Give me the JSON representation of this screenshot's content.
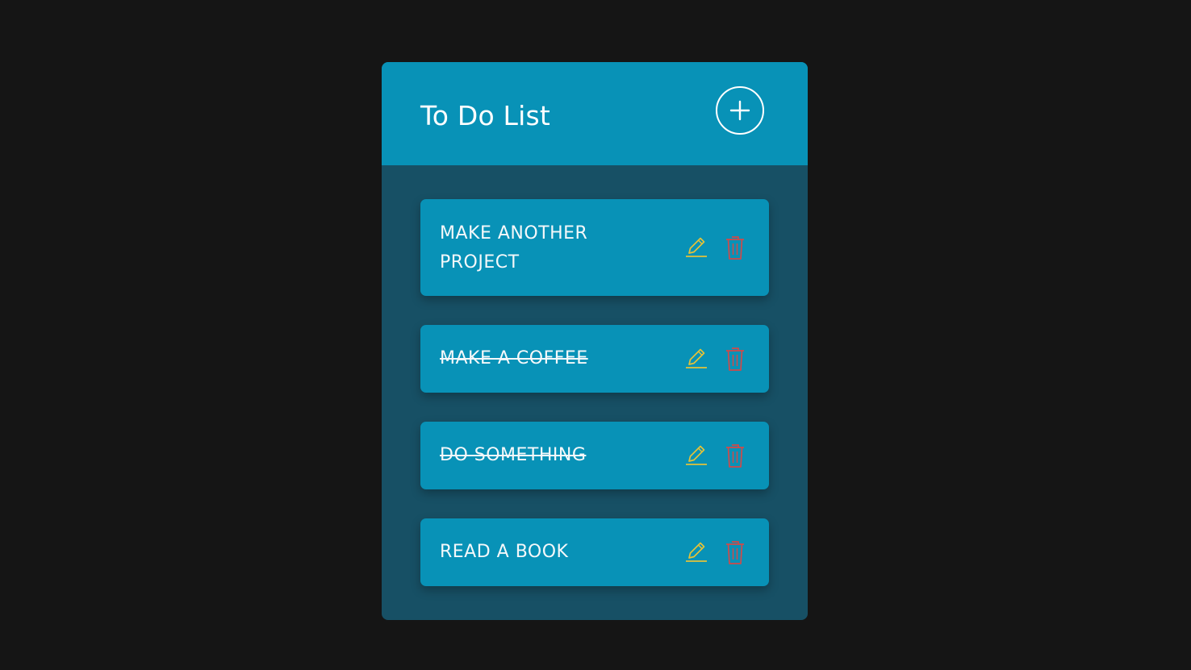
{
  "header": {
    "title": "To Do List"
  },
  "items": [
    {
      "label": "Make another project",
      "completed": false
    },
    {
      "label": "Make a coffee",
      "completed": true
    },
    {
      "label": "Do something",
      "completed": true
    },
    {
      "label": "Read a book",
      "completed": false
    }
  ],
  "icons": {
    "add": "plus-circle-icon",
    "edit": "pencil-icon",
    "delete": "trash-icon"
  },
  "colors": {
    "background": "#151515",
    "card": "#175065",
    "accent": "#0892b7",
    "edit": "#e2c23a",
    "delete": "#d04a4a",
    "text": "#ffffff"
  }
}
